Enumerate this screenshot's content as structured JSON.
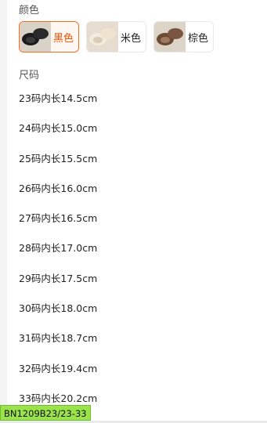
{
  "color_section": {
    "label": "颜色",
    "options": [
      {
        "name": "黑色",
        "selected": true,
        "icon": "black-slipper-thumbnail"
      },
      {
        "name": "米色",
        "selected": false,
        "icon": "beige-slipper-thumbnail"
      },
      {
        "name": "棕色",
        "selected": false,
        "icon": "brown-slipper-thumbnail"
      }
    ]
  },
  "size_section": {
    "label": "尺码",
    "options": [
      "23码内长14.5cm",
      "24码内长15.0cm",
      "25码内长15.5cm",
      "26码内长16.0cm",
      "27码内长16.5cm",
      "28码内长17.0cm",
      "29码内长17.5cm",
      "30码内长18.0cm",
      "31码内长18.7cm",
      "32码内长19.4cm",
      "33码内长20.2cm"
    ]
  },
  "sku_code": "BN1209B23/23-33",
  "colors": {
    "accent": "#ff5000",
    "badge_bg": "#9be34a"
  }
}
